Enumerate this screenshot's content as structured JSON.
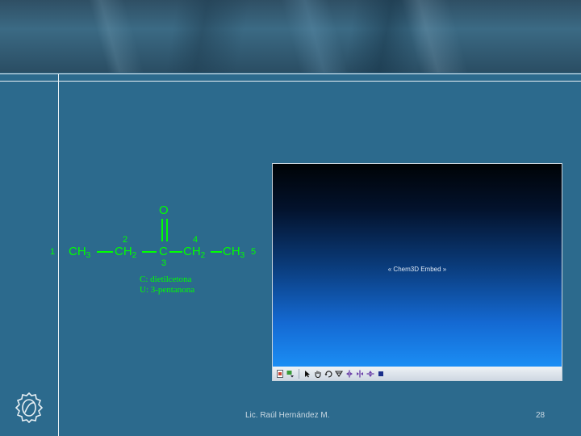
{
  "molecule": {
    "oxygen": "O",
    "carbon_center": "C",
    "groups": {
      "ch3_left": "CH",
      "ch3_left_sub": "3",
      "ch2_left": "CH",
      "ch2_left_sub": "2",
      "ch2_right": "CH",
      "ch2_right_sub": "2",
      "ch3_right": "CH",
      "ch3_right_sub": "3"
    },
    "numbers": {
      "n1": "1",
      "n2": "2",
      "n3": "3",
      "n4": "4",
      "n5": "5"
    },
    "common_name": "C: dietilcetona",
    "iupac_name": "U: 3-pentanona",
    "color": "#00ff00"
  },
  "embed": {
    "label": "« Chem3D Embed »",
    "toolbar_icons": [
      "page-icon",
      "dropdown-icon",
      "select-arrow-icon",
      "hand-icon",
      "rotate-icon",
      "zoom-icon",
      "rotate-y-icon",
      "rotate-x-icon",
      "trim-icon",
      "stop-icon"
    ]
  },
  "footer": {
    "author": "Lic. Raúl Hernández M.",
    "page_number": "28"
  },
  "colors": {
    "background": "#2c6a8d",
    "rule": "#e8f0f4"
  }
}
